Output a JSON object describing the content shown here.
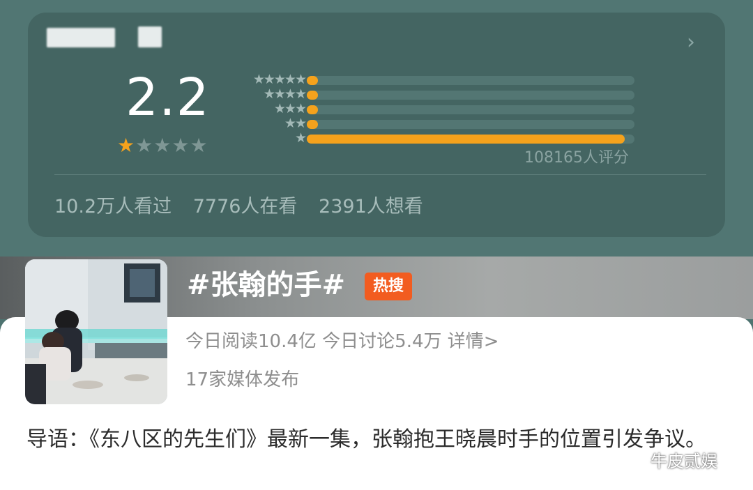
{
  "rating": {
    "score": "2.2",
    "score_stars_filled": 1,
    "score_stars_total": 5,
    "distribution": [
      {
        "stars": "★★★★★",
        "fraction": 0.03
      },
      {
        "stars": "★★★★",
        "fraction": 0.03
      },
      {
        "stars": "★★★",
        "fraction": 0.03
      },
      {
        "stars": "★★",
        "fraction": 0.03
      },
      {
        "stars": "★",
        "fraction": 0.97
      }
    ],
    "count_text": "108165人评分",
    "stats": [
      "10.2万人看过",
      "7776人在看",
      "2391人想看"
    ],
    "chevron": "chevron-right-icon",
    "colors": {
      "accent": "#f5a21c",
      "card": "#446562"
    }
  },
  "hot": {
    "title": "#张翰的手#",
    "badge": "热搜",
    "stats": "今日阅读10.4亿 今日讨论5.4万 详情>",
    "media": "17家媒体发布"
  },
  "intro": "导语：《东八区的先生们》最新一集，张翰抱王晓晨时手的位置引发争议。",
  "watermark": "牛皮贰娱"
}
